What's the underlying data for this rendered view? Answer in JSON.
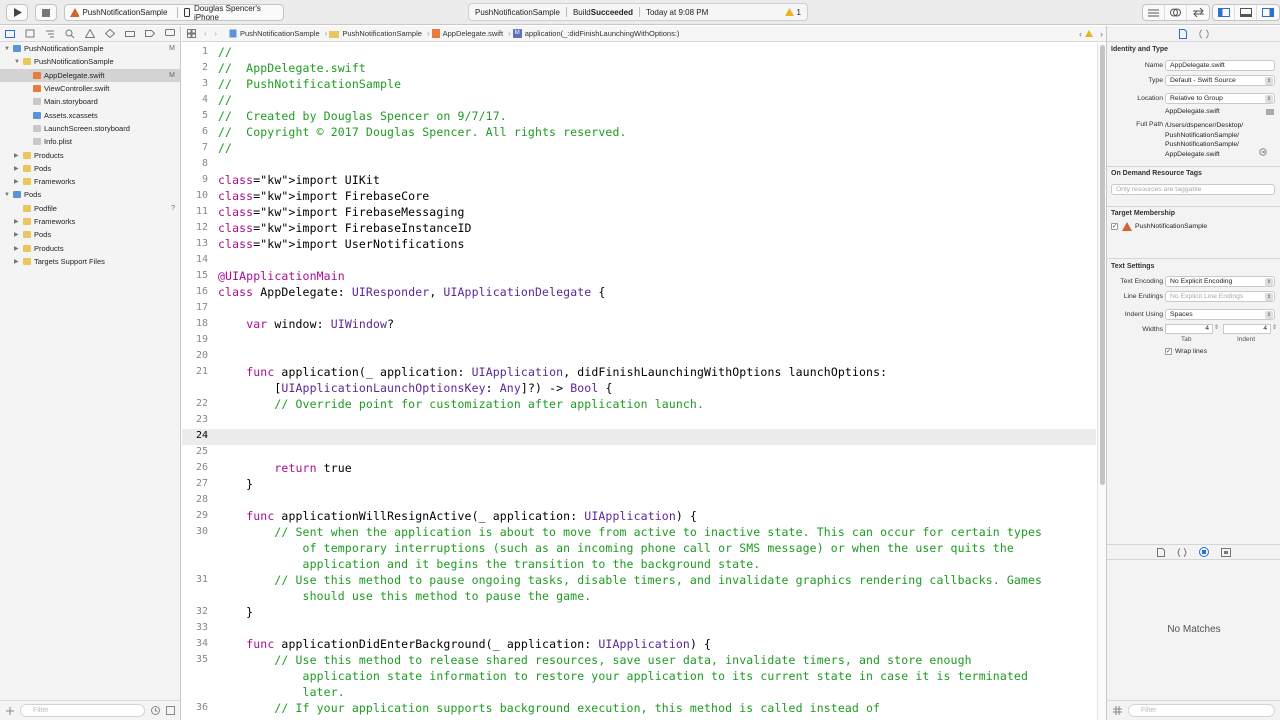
{
  "toolbar": {
    "scheme_target": "PushNotificationSample",
    "scheme_device": "Douglas Spencer's iPhone",
    "status_project": "PushNotificationSample",
    "status_build_prefix": "Build ",
    "status_build_result": "Succeeded",
    "status_time": "Today at 9:08 PM",
    "warning_count": "1"
  },
  "navigator": {
    "items": [
      {
        "label": "PushNotificationSample",
        "badge": "M",
        "indent": 0,
        "type": "project",
        "open": true
      },
      {
        "label": "PushNotificationSample",
        "badge": "",
        "indent": 1,
        "type": "folder",
        "open": true
      },
      {
        "label": "AppDelegate.swift",
        "badge": "M",
        "indent": 2,
        "type": "swift",
        "selected": true
      },
      {
        "label": "ViewController.swift",
        "badge": "",
        "indent": 2,
        "type": "swift"
      },
      {
        "label": "Main.storyboard",
        "badge": "",
        "indent": 2,
        "type": "file"
      },
      {
        "label": "Assets.xcassets",
        "badge": "",
        "indent": 2,
        "type": "folder-b"
      },
      {
        "label": "LaunchScreen.storyboard",
        "badge": "",
        "indent": 2,
        "type": "file"
      },
      {
        "label": "Info.plist",
        "badge": "",
        "indent": 2,
        "type": "file"
      },
      {
        "label": "Products",
        "badge": "",
        "indent": 1,
        "type": "folder",
        "closed": true
      },
      {
        "label": "Pods",
        "badge": "",
        "indent": 1,
        "type": "folder",
        "closed": true
      },
      {
        "label": "Frameworks",
        "badge": "",
        "indent": 1,
        "type": "folder",
        "closed": true
      },
      {
        "label": "Pods",
        "badge": "",
        "indent": 0,
        "type": "project",
        "open": true
      },
      {
        "label": "Podfile",
        "badge": "?",
        "indent": 1,
        "type": "podfile"
      },
      {
        "label": "Frameworks",
        "badge": "",
        "indent": 1,
        "type": "folder",
        "closed": true
      },
      {
        "label": "Pods",
        "badge": "",
        "indent": 1,
        "type": "folder",
        "closed": true
      },
      {
        "label": "Products",
        "badge": "",
        "indent": 1,
        "type": "folder",
        "closed": true
      },
      {
        "label": "Targets Support Files",
        "badge": "",
        "indent": 1,
        "type": "folder",
        "closed": true
      }
    ],
    "filter_placeholder": "Filter"
  },
  "jumpbar": {
    "crumbs": [
      "PushNotificationSample",
      "PushNotificationSample",
      "AppDelegate.swift",
      "application(_:didFinishLaunchingWithOptions:)"
    ],
    "method_badge": "M"
  },
  "editor": {
    "current_line": "24",
    "lines": [
      {
        "n": "1",
        "t": "//"
      },
      {
        "n": "2",
        "t": "//  AppDelegate.swift"
      },
      {
        "n": "3",
        "t": "//  PushNotificationSample"
      },
      {
        "n": "4",
        "t": "//"
      },
      {
        "n": "5",
        "t": "//  Created by Douglas Spencer on 9/7/17."
      },
      {
        "n": "6",
        "t": "//  Copyright © 2017 Douglas Spencer. All rights reserved."
      },
      {
        "n": "7",
        "t": "//"
      },
      {
        "n": "8",
        "t": ""
      },
      {
        "n": "9",
        "t": "import UIKit"
      },
      {
        "n": "10",
        "t": "import FirebaseCore"
      },
      {
        "n": "11",
        "t": "import FirebaseMessaging"
      },
      {
        "n": "12",
        "t": "import FirebaseInstanceID"
      },
      {
        "n": "13",
        "t": "import UserNotifications"
      },
      {
        "n": "14",
        "t": ""
      },
      {
        "n": "15",
        "t": "@UIApplicationMain"
      },
      {
        "n": "16",
        "t": "class AppDelegate: UIResponder, UIApplicationDelegate {"
      },
      {
        "n": "17",
        "t": ""
      },
      {
        "n": "18",
        "t": "    var window: UIWindow?"
      },
      {
        "n": "19",
        "t": ""
      },
      {
        "n": "20",
        "t": ""
      },
      {
        "n": "21",
        "t": "    func application(_ application: UIApplication, didFinishLaunchingWithOptions launchOptions:"
      },
      {
        "n": "",
        "t": "        [UIApplicationLaunchOptionsKey: Any]?) -> Bool {"
      },
      {
        "n": "22",
        "t": "        // Override point for customization after application launch."
      },
      {
        "n": "23",
        "t": ""
      },
      {
        "n": "24",
        "t": ""
      },
      {
        "n": "25",
        "t": ""
      },
      {
        "n": "26",
        "t": "        return true"
      },
      {
        "n": "27",
        "t": "    }"
      },
      {
        "n": "28",
        "t": ""
      },
      {
        "n": "29",
        "t": "    func applicationWillResignActive(_ application: UIApplication) {"
      },
      {
        "n": "30",
        "t": "        // Sent when the application is about to move from active to inactive state. This can occur for certain types"
      },
      {
        "n": "",
        "t": "            of temporary interruptions (such as an incoming phone call or SMS message) or when the user quits the"
      },
      {
        "n": "",
        "t": "            application and it begins the transition to the background state."
      },
      {
        "n": "31",
        "t": "        // Use this method to pause ongoing tasks, disable timers, and invalidate graphics rendering callbacks. Games"
      },
      {
        "n": "",
        "t": "            should use this method to pause the game."
      },
      {
        "n": "32",
        "t": "    }"
      },
      {
        "n": "33",
        "t": ""
      },
      {
        "n": "34",
        "t": "    func applicationDidEnterBackground(_ application: UIApplication) {"
      },
      {
        "n": "35",
        "t": "        // Use this method to release shared resources, save user data, invalidate timers, and store enough"
      },
      {
        "n": "",
        "t": "            application state information to restore your application to its current state in case it is terminated"
      },
      {
        "n": "",
        "t": "            later."
      },
      {
        "n": "36",
        "t": "        // If your application supports background execution, this method is called instead of"
      }
    ]
  },
  "inspector": {
    "identity_title": "Identity and Type",
    "name_label": "Name",
    "name_value": "AppDelegate.swift",
    "type_label": "Type",
    "type_value": "Default - Swift Source",
    "location_label": "Location",
    "location_value": "Relative to Group",
    "location_file": "AppDelegate.swift",
    "fullpath_label": "Full Path",
    "fullpath_lines": [
      "/Users/dspencer/Desktop/",
      "PushNotificationSample/",
      "PushNotificationSample/",
      "AppDelegate.swift"
    ],
    "odr_title": "On Demand Resource Tags",
    "odr_placeholder": "Only resources are taggable",
    "target_title": "Target Membership",
    "target_item": "PushNotificationSample",
    "text_settings_title": "Text Settings",
    "encoding_label": "Text Encoding",
    "encoding_value": "No Explicit Encoding",
    "endings_label": "Line Endings",
    "endings_value": "No Explicit Line Endings",
    "indent_label": "Indent Using",
    "indent_value": "Spaces",
    "widths_label": "Widths",
    "tab_width": "4",
    "indent_width": "4",
    "tab_caption": "Tab",
    "indent_caption": "Indent",
    "wrap_label": "Wrap lines",
    "no_matches": "No Matches",
    "filter_placeholder": "Filter"
  },
  "colors": {
    "keyword": "#aa0d91",
    "comment": "#1d9b22",
    "type": "#5c2699",
    "selection": "#d3d3d3"
  }
}
